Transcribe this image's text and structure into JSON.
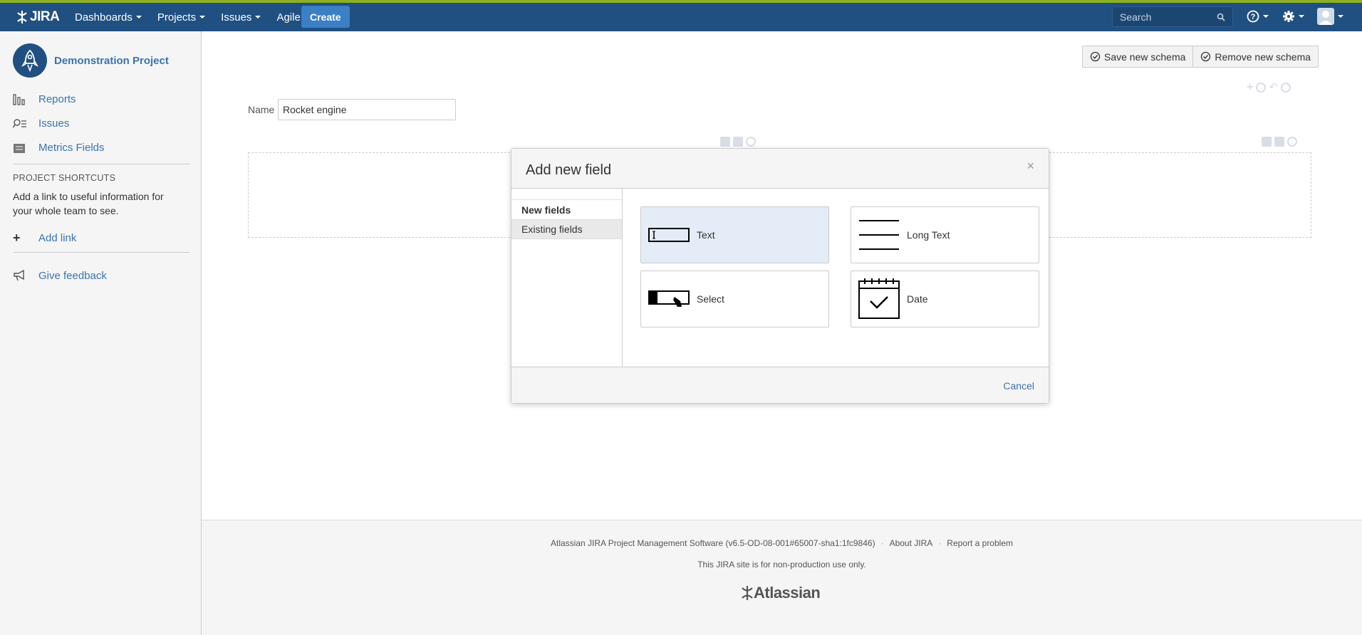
{
  "header": {
    "logo": "JIRA",
    "nav": [
      "Dashboards",
      "Projects",
      "Issues",
      "Agile"
    ],
    "create": "Create",
    "search_placeholder": "Search"
  },
  "sidebar": {
    "project_name": "Demonstration Project",
    "links": [
      "Reports",
      "Issues",
      "Metrics Fields"
    ],
    "shortcuts_heading": "PROJECT SHORTCUTS",
    "shortcuts_text": "Add a link to useful information for your whole team to see.",
    "add_link": "Add link",
    "feedback": "Give feedback"
  },
  "main": {
    "save_schema": "Save new schema",
    "remove_schema": "Remove new schema",
    "name_label": "Name",
    "name_value": "Rocket engine"
  },
  "dialog": {
    "title": "Add new field",
    "close": "×",
    "tabs": [
      "New fields",
      "Existing fields"
    ],
    "field_types": [
      "Text",
      "Long Text",
      "Select",
      "Date"
    ],
    "cancel": "Cancel"
  },
  "footer": {
    "version": "Atlassian JIRA Project Management Software (v6.5-OD-08-001#65007-sha1:1fc9846)",
    "about": "About JIRA",
    "report": "Report a problem",
    "notice": "This JIRA site is for non-production use only.",
    "brand": "Atlassian"
  },
  "colors": {
    "header_bg": "#205081",
    "accent_strip": "#8eb021",
    "link": "#3b73af",
    "create_button": "#3b7fc4",
    "selected_field": "#e4ecf7"
  }
}
